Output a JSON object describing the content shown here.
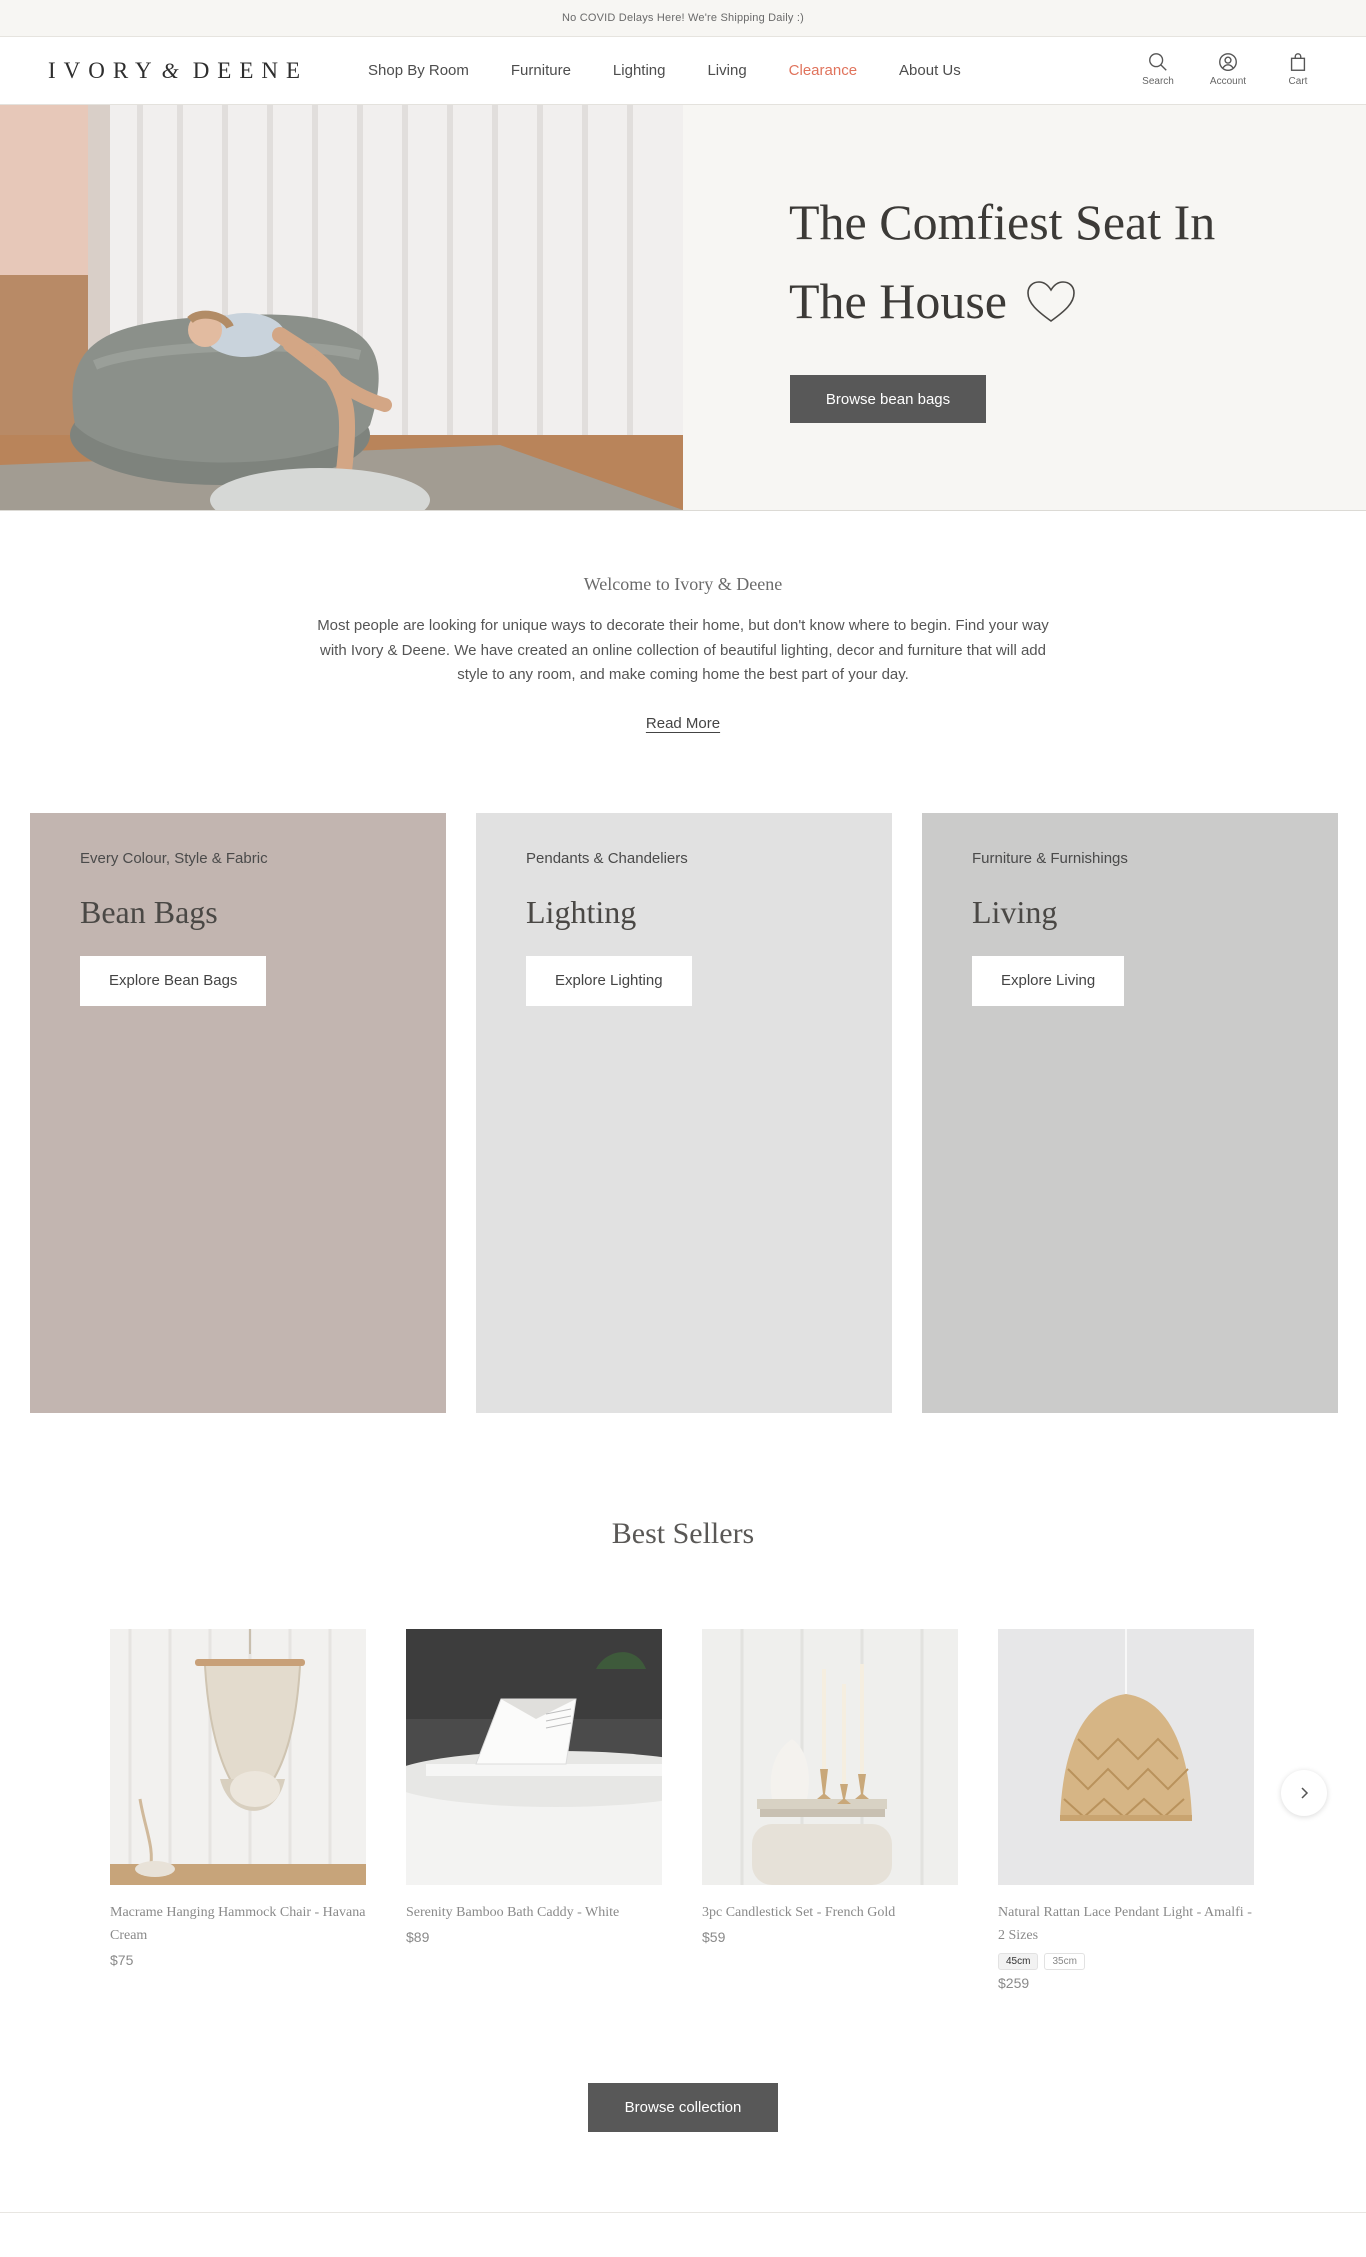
{
  "announcement": "No COVID Delays Here! We're Shipping Daily :)",
  "logo": {
    "part1": "IVORY",
    "amp": "&",
    "part2": "DEENE"
  },
  "nav": [
    {
      "label": "Shop By Room"
    },
    {
      "label": "Furniture"
    },
    {
      "label": "Lighting"
    },
    {
      "label": "Living"
    },
    {
      "label": "Clearance"
    },
    {
      "label": "About Us"
    }
  ],
  "header_icons": {
    "search": "Search",
    "account": "Account",
    "cart": "Cart"
  },
  "hero": {
    "title_line1": "The Comfiest Seat In",
    "title_line2": "The House",
    "button": "Browse bean bags"
  },
  "welcome": {
    "title": "Welcome to Ivory & Deene",
    "body": "Most people are looking for unique ways to decorate their home, but don't know where to begin. Find your way with Ivory & Deene. We have created an online collection of beautiful lighting, decor and furniture that will add style to any room, and make coming home the best part of your day.",
    "read_more": "Read More"
  },
  "tiles": [
    {
      "eyebrow": "Every Colour, Style & Fabric",
      "title": "Bean Bags",
      "button": "Explore Bean Bags",
      "bg": "#c2b5b0"
    },
    {
      "eyebrow": "Pendants & Chandeliers",
      "title": "Lighting",
      "button": "Explore Lighting",
      "bg": "#e1e1e1"
    },
    {
      "eyebrow": "Furniture & Furnishings",
      "title": "Living",
      "button": "Explore Living",
      "bg": "#cbcbca"
    }
  ],
  "best_sellers": {
    "title": "Best Sellers",
    "products": [
      {
        "name": "Macrame Hanging Hammock Chair - Havana Cream",
        "price": "$75",
        "icon": "hammock-chair"
      },
      {
        "name": "Serenity Bamboo Bath Caddy - White",
        "price": "$89",
        "icon": "bath-caddy"
      },
      {
        "name": "3pc Candlestick Set - French Gold",
        "price": "$59",
        "icon": "candlesticks"
      },
      {
        "name": "Natural Rattan Lace Pendant Light - Amalfi - 2 Sizes",
        "price": "$259",
        "icon": "rattan-pendant",
        "sizes": [
          "45cm",
          "35cm"
        ]
      }
    ],
    "browse_button": "Browse collection"
  },
  "colors": {
    "accent_clearance": "#e0735c",
    "button_dark": "#585858",
    "hero_bg": "#f7f6f3"
  }
}
